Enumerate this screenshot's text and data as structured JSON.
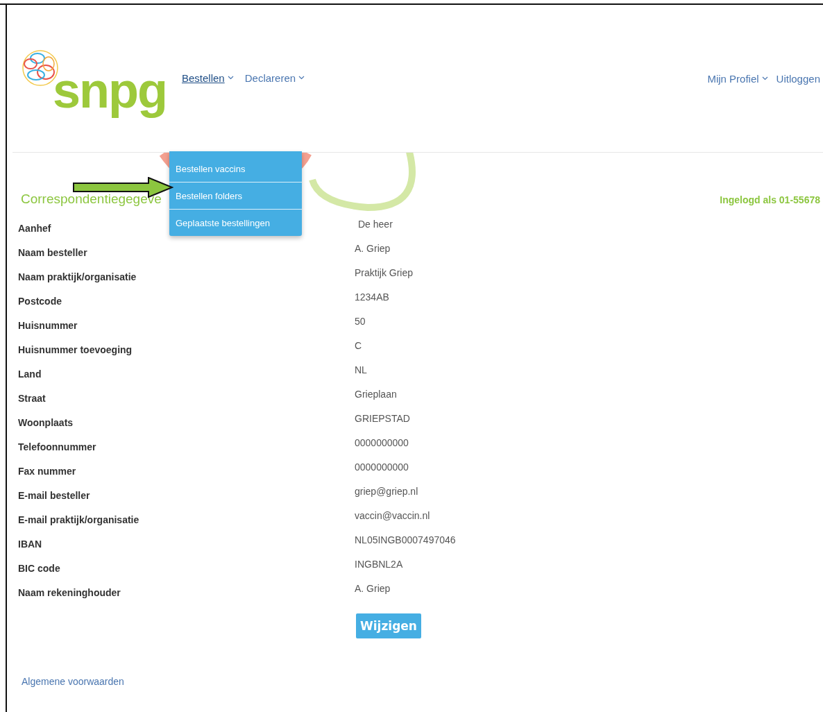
{
  "logo": {
    "text": "snpg"
  },
  "nav": [
    {
      "label": "Bestellen",
      "expanded": true
    },
    {
      "label": "Declareren",
      "expanded": false
    }
  ],
  "nav_right": [
    {
      "label": "Mijn Profiel",
      "kind": "dropdown"
    },
    {
      "label": "Uitloggen",
      "kind": "link"
    }
  ],
  "dropdown": {
    "items": [
      {
        "label": "Bestellen vaccins"
      },
      {
        "label": "Bestellen folders"
      },
      {
        "label": "Geplaatste bestellingen"
      }
    ]
  },
  "heading": "Correspondentiegegeve",
  "logged_in": "Ingelogd als 01-55678",
  "fields": [
    {
      "label": "Aanhef",
      "value": "De heer"
    },
    {
      "label": "Naam besteller",
      "value": "A. Griep"
    },
    {
      "label": "Naam praktijk/organisatie",
      "value": "Praktijk Griep"
    },
    {
      "label": "Postcode",
      "value": "1234AB"
    },
    {
      "label": "Huisnummer",
      "value": "50"
    },
    {
      "label": "Huisnummer toevoeging",
      "value": "C"
    },
    {
      "label": "Land",
      "value": "NL"
    },
    {
      "label": "Straat",
      "value": "Grieplaan"
    },
    {
      "label": "Woonplaats",
      "value": "GRIEPSTAD"
    },
    {
      "label": "Telefoonnummer",
      "value": "0000000000"
    },
    {
      "label": "Fax nummer",
      "value": "0000000000"
    },
    {
      "label": "E-mail besteller",
      "value": "griep@griep.nl"
    },
    {
      "label": "E-mail praktijk/organisatie",
      "value": "vaccin@vaccin.nl"
    },
    {
      "label": "IBAN",
      "value": "NL05INGB0007497046"
    },
    {
      "label": "BIC code",
      "value": "INGBNL2A"
    },
    {
      "label": "Naam rekeninghouder",
      "value": "A. Griep"
    }
  ],
  "button": "Wijzigen",
  "footer_link": "Algemene voorwaarden"
}
